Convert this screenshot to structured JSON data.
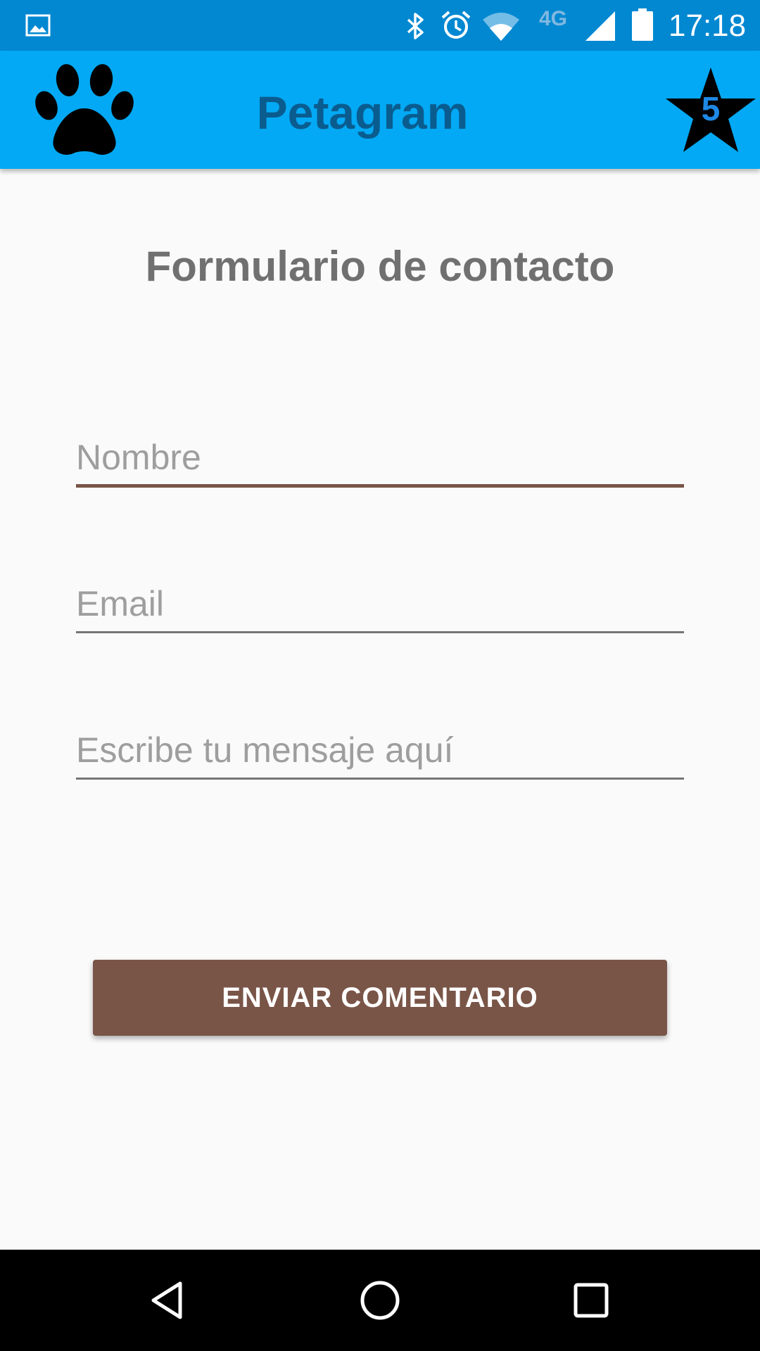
{
  "status_bar": {
    "time": "17:18",
    "network_type": "4G",
    "icons": [
      "gallery-icon",
      "bluetooth-icon",
      "alarm-icon",
      "wifi-icon",
      "signal-icon",
      "battery-icon"
    ]
  },
  "app_bar": {
    "title": "Petagram",
    "logo_icon": "paw-icon",
    "favorites_icon": "star-icon",
    "favorites_count": "5",
    "color": "#03a9f4",
    "title_color": "#0a5c8f"
  },
  "form": {
    "title": "Formulario de contacto",
    "name_placeholder": "Nombre",
    "email_placeholder": "Email",
    "message_placeholder": "Escribe tu mensaje aquí",
    "submit_label": "ENVIAR COMENTARIO",
    "accent_color": "#795548"
  },
  "nav_bar": {
    "icons": [
      "back-icon",
      "home-icon",
      "recents-icon"
    ]
  }
}
